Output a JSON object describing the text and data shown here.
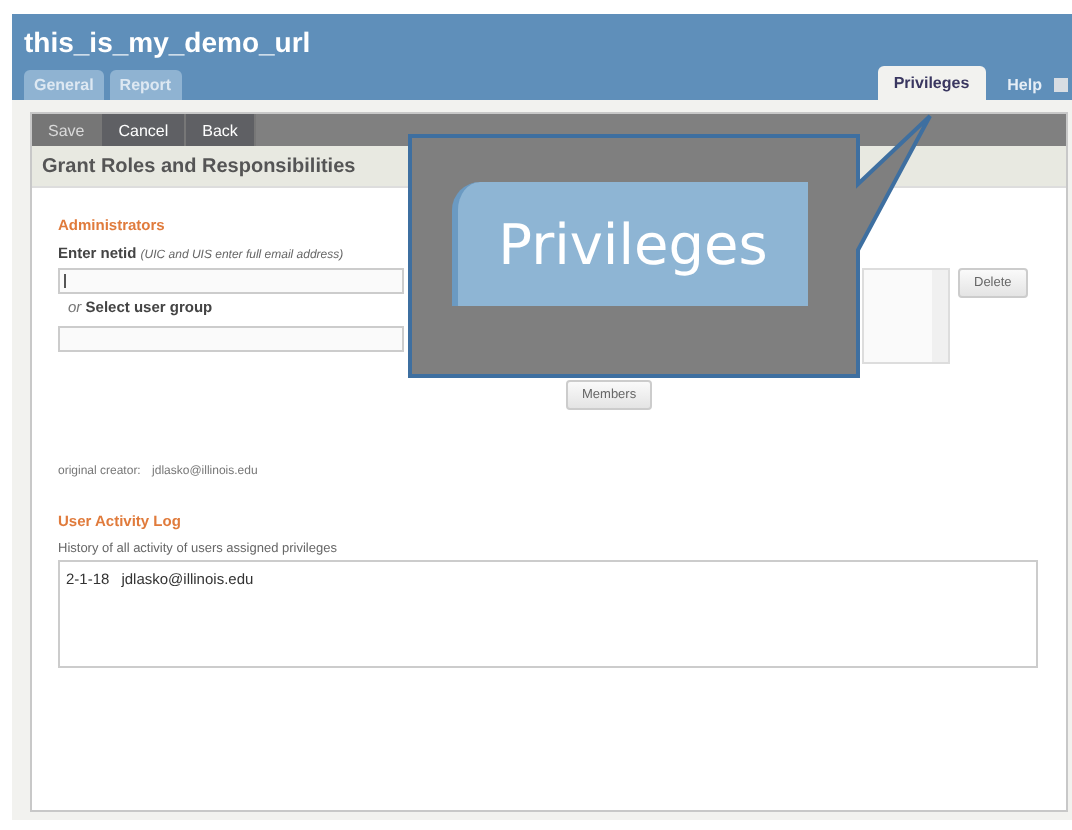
{
  "window": {
    "title": "this_is_my_demo_url"
  },
  "tabs": [
    {
      "label": "General",
      "selected": false
    },
    {
      "label": "Report",
      "selected": false
    },
    {
      "label": "Privileges",
      "selected": true
    }
  ],
  "help": {
    "label": "Help"
  },
  "toolbar": [
    {
      "label": "Save",
      "disabled": true
    },
    {
      "label": "Cancel",
      "disabled": false
    },
    {
      "label": "Back",
      "disabled": false
    }
  ],
  "section_title": "Grant Roles and Responsibilities",
  "administrators": {
    "heading": "Administrators",
    "netid_label": "Enter netid",
    "netid_hint": "(UIC and UIS enter full email address)",
    "or": "or",
    "group_label": "Select user group",
    "delete": "Delete",
    "members": "Members"
  },
  "creator": {
    "label": "original creator:",
    "value": "jdlasko@illinois.edu"
  },
  "activity_log": {
    "heading": "User Activity Log",
    "description": "History of all activity of users assigned privileges",
    "entries": [
      {
        "date": "2-1-18",
        "user": "jdlasko@illinois.edu"
      }
    ]
  },
  "callout": {
    "text": "Privileges"
  }
}
